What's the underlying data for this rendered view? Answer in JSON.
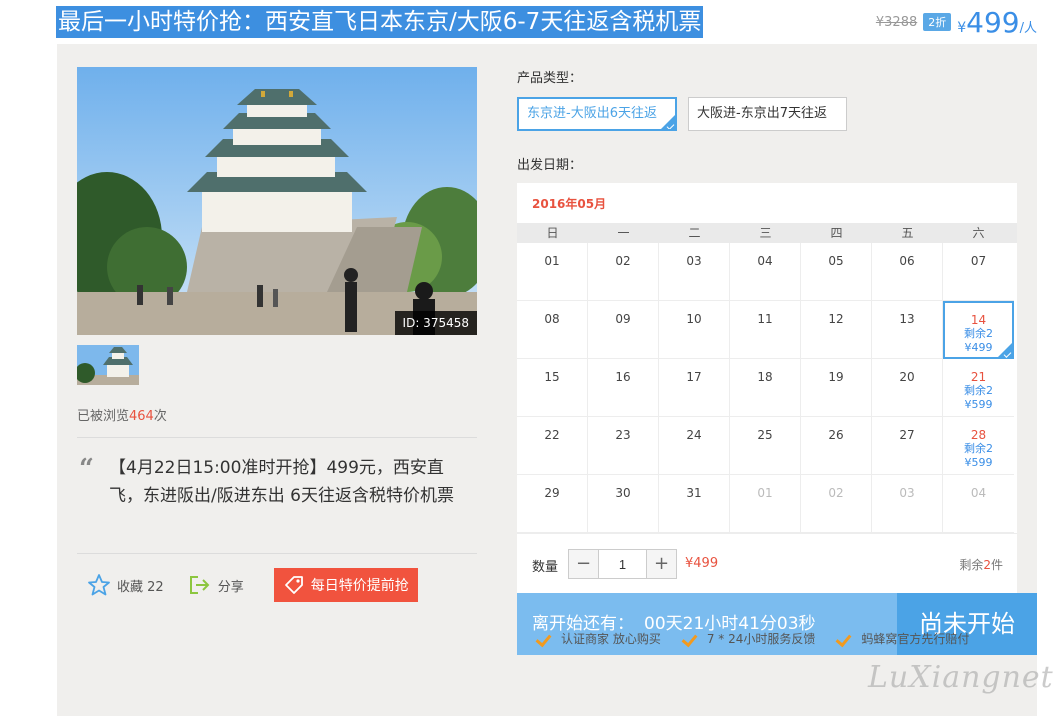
{
  "header": {
    "title": "最后一小时特价抢：西安直飞日本东京/大阪6-7天往返含税机票",
    "old_price": "¥3288",
    "discount": "2折",
    "price_symbol": "¥",
    "price": "499",
    "price_unit": "/人"
  },
  "gallery": {
    "id_tag": "ID: 375458",
    "views_prefix": "已被浏览",
    "views_count": "464",
    "views_suffix": "次"
  },
  "description": {
    "quote": "“",
    "text": "【4月22日15:00准时开抢】499元，西安直飞，东进阪出/阪进东出 6天往返含税特价机票"
  },
  "actions": {
    "favorite_label": "收藏 22",
    "share_label": "分享",
    "promo_label": "每日特价提前抢"
  },
  "product": {
    "type_label": "产品类型：",
    "types": [
      "东京进-大阪出6天往返",
      "大阪进-东京出7天往返"
    ],
    "date_label": "出发日期："
  },
  "calendar": {
    "month": "2016年05月",
    "weekdays": [
      "日",
      "一",
      "二",
      "三",
      "四",
      "五",
      "六"
    ],
    "weeks": [
      [
        {
          "d": "01"
        },
        {
          "d": "02"
        },
        {
          "d": "03"
        },
        {
          "d": "04"
        },
        {
          "d": "05"
        },
        {
          "d": "06"
        },
        {
          "d": "07"
        }
      ],
      [
        {
          "d": "08"
        },
        {
          "d": "09"
        },
        {
          "d": "10"
        },
        {
          "d": "11"
        },
        {
          "d": "12"
        },
        {
          "d": "13"
        },
        {
          "d": "14",
          "avail": true,
          "left": "剩余2",
          "price": "¥499",
          "selected": true
        }
      ],
      [
        {
          "d": "15"
        },
        {
          "d": "16"
        },
        {
          "d": "17"
        },
        {
          "d": "18"
        },
        {
          "d": "19"
        },
        {
          "d": "20"
        },
        {
          "d": "21",
          "avail": true,
          "left": "剩余2",
          "price": "¥599"
        }
      ],
      [
        {
          "d": "22"
        },
        {
          "d": "23"
        },
        {
          "d": "24"
        },
        {
          "d": "25"
        },
        {
          "d": "26"
        },
        {
          "d": "27"
        },
        {
          "d": "28",
          "avail": true,
          "left": "剩余2",
          "price": "¥599"
        }
      ],
      [
        {
          "d": "29"
        },
        {
          "d": "30"
        },
        {
          "d": "31"
        },
        {
          "d": "01",
          "other": true
        },
        {
          "d": "02",
          "other": true
        },
        {
          "d": "03",
          "other": true
        },
        {
          "d": "04",
          "other": true
        }
      ]
    ]
  },
  "quantity": {
    "label": "数量",
    "minus": "−",
    "plus": "+",
    "value": "1",
    "price": "¥499",
    "stock_prefix": "剩余",
    "stock_count": "2",
    "stock_suffix": "件"
  },
  "countdown": {
    "label": "离开始还有：",
    "time": "00天21小时41分03秒",
    "status": "尚未开始"
  },
  "guarantees": [
    "认证商家 放心购买",
    "7 * 24小时服务反馈",
    "蚂蜂窝官方先行赔付"
  ],
  "watermark": "LuXiangnet",
  "colors": {
    "accent_blue": "#4ba3e6",
    "title_highlight": "#3d8fe0",
    "price_red": "#e8523f",
    "promo_red": "#f1533e",
    "check_orange": "#f29a1f"
  }
}
